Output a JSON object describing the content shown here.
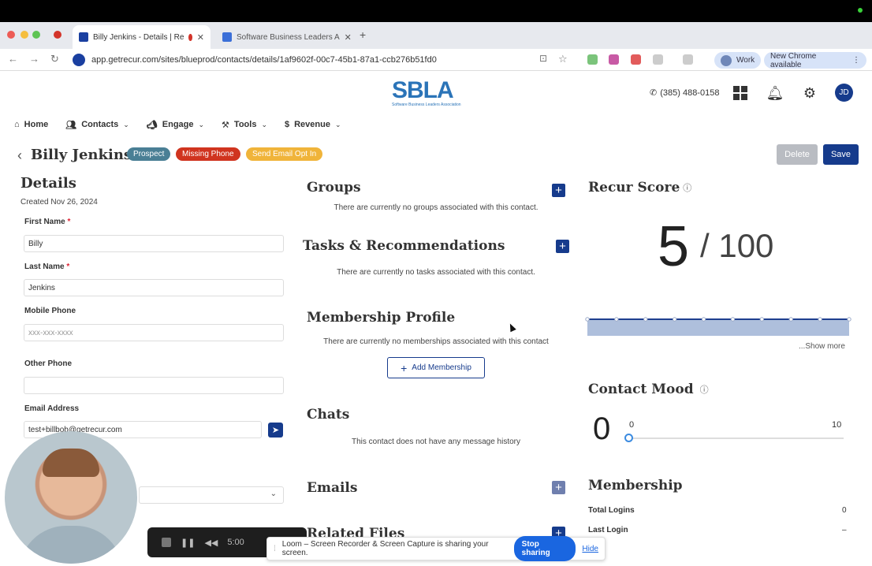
{
  "browser": {
    "tabs": [
      {
        "title": "Billy Jenkins - Details | Re"
      },
      {
        "title": "Software Business Leaders A"
      }
    ],
    "new_tab_symbol": "+",
    "url": "app.getrecur.com/sites/blueprod/contacts/details/1af9602f-00c7-45b1-87a1-ccb276b51fd0",
    "profile_label": "Work",
    "update_label": "New Chrome available"
  },
  "header": {
    "logo_text": "SBLA",
    "logo_subtext": "Software Business Leaders Association",
    "phone": "(385) 488-0158",
    "avatar_initials": "JD"
  },
  "nav": {
    "home": "Home",
    "contacts": "Contacts",
    "engage": "Engage",
    "tools": "Tools",
    "revenue": "Revenue"
  },
  "contact": {
    "name": "Billy Jenkins",
    "badges": [
      {
        "label": "Prospect",
        "color": "#4a7f95"
      },
      {
        "label": "Missing Phone",
        "color": "#d0341f"
      },
      {
        "label": "Send Email Opt In",
        "color": "#f0b43a"
      }
    ],
    "delete_label": "Delete",
    "save_label": "Save"
  },
  "details": {
    "title": "Details",
    "created": "Created Nov 26, 2024",
    "first_name_label": "First Name",
    "first_name_value": "Billy",
    "last_name_label": "Last Name",
    "last_name_value": "Jenkins",
    "mobile_phone_label": "Mobile Phone",
    "mobile_phone_placeholder": "xxx-xxx-xxxx",
    "other_phone_label": "Other Phone",
    "email_label": "Email Address",
    "email_value": "test+billbob@getrecur.com",
    "required_marker": "*"
  },
  "groups": {
    "title": "Groups",
    "empty": "There are currently no groups associated with this contact."
  },
  "tasks": {
    "title": "Tasks & Recommendations",
    "empty": "There are currently no tasks associated with this contact."
  },
  "membership_profile": {
    "title": "Membership Profile",
    "empty": "There are currently no memberships associated with this contact",
    "add_label": "Add Membership"
  },
  "chats": {
    "title": "Chats",
    "empty": "This contact does not have any message history"
  },
  "emails": {
    "title": "Emails"
  },
  "related_files": {
    "title": "Related Files"
  },
  "recur_score": {
    "title": "Recur Score",
    "score": "5",
    "out_of": "/ 100",
    "show_more": "...Show more",
    "trend": [
      5,
      5,
      5,
      5,
      5,
      5,
      5,
      5,
      5,
      5
    ]
  },
  "contact_mood": {
    "title": "Contact Mood",
    "value": "0",
    "min": "0",
    "max": "10",
    "level": 0
  },
  "membership": {
    "title": "Membership",
    "total_logins_label": "Total Logins",
    "total_logins_value": "0",
    "last_login_label": "Last Login",
    "last_login_value": "–"
  },
  "recorder": {
    "time": "5:00",
    "notice": "Loom – Screen Recorder & Screen Capture is sharing your screen.",
    "stop_label": "Stop sharing",
    "hide_label": "Hide"
  },
  "colors": {
    "primary": "#163b8c",
    "score_line": "#1f3f8f",
    "score_fill": "#aebfdc"
  }
}
